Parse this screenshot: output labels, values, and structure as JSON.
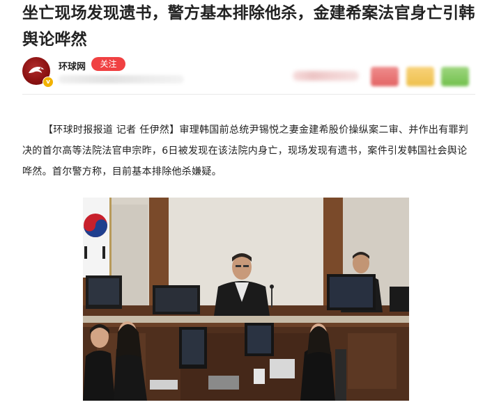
{
  "article": {
    "title": "坐亡现场发现遗书，警方基本排除他杀，金建希案法官身亡引韩舆论哗然",
    "body": "【环球时报报道 记者 任伊然】审理韩国前总统尹锡悦之妻金建希股价操纵案二审、并作出有罪判决的首尔高等法院法官申宗昨，6日被发现在该法院内身亡，现场发现有遗书，案件引发韩国社会舆论哗然。首尔警方称，目前基本排除他杀嫌疑。"
  },
  "author": {
    "name": "环球网",
    "follow_label": "关注",
    "avatar_icon": "eagle-logo-icon",
    "badge_icon": "verified-badge-icon",
    "avatar_color": "#8a1111",
    "badge_color": "#f2b200"
  },
  "share": {
    "icons": [
      "share-icon-red",
      "share-icon-yellow",
      "share-icon-green"
    ],
    "colors": [
      "#e36464",
      "#eec04c",
      "#72c04d"
    ]
  },
  "colors": {
    "follow_button": "#f04142",
    "text": "#222222"
  },
  "photo": {
    "description_icon": "courtroom-photo"
  }
}
